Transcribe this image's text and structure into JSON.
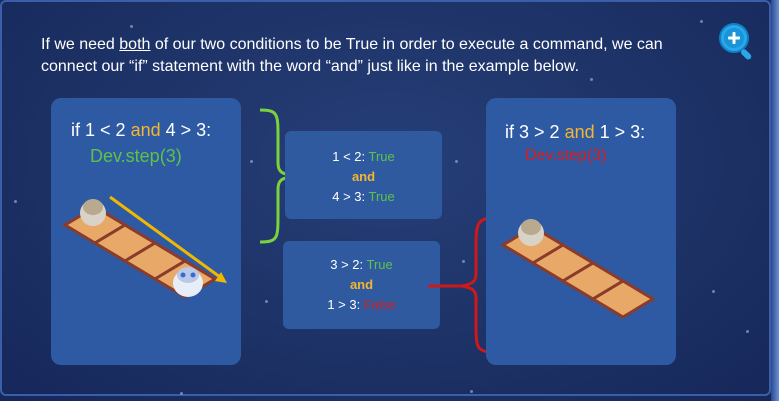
{
  "intro": {
    "part1": "If we need ",
    "emphasis": "both",
    "part2": " of our two conditions to be True in order to execute a command, we can connect our “if” statement with the word “and” just like in the example below."
  },
  "zoom_icon": "zoom-in-icon",
  "left_example": {
    "if_kw": "if",
    "cond1": "1 < 2",
    "and_kw": "and",
    "cond2": "4 > 3:",
    "command": "Dev.step(3)"
  },
  "right_example": {
    "if_kw": "if",
    "cond1": "3 > 2",
    "and_kw": "and",
    "cond2": "1 > 3:",
    "command": "Dev.step(3)"
  },
  "eval_true": {
    "line1_expr": "1 < 2:",
    "line1_result": "True",
    "and_kw": "and",
    "line2_expr": "4 > 3:",
    "line2_result": "True"
  },
  "eval_false": {
    "line1_expr": "3 > 2:",
    "line1_result": "True",
    "and_kw": "and",
    "line2_expr": "1 > 3:",
    "line2_result": "False"
  },
  "colors": {
    "and_keyword": "#f2b632",
    "true_green": "#5cc24a",
    "false_red": "#d61e1e",
    "arrow_yellow": "#f2b800",
    "bracket_green": "#7bd23a",
    "bracket_red": "#d01818"
  }
}
